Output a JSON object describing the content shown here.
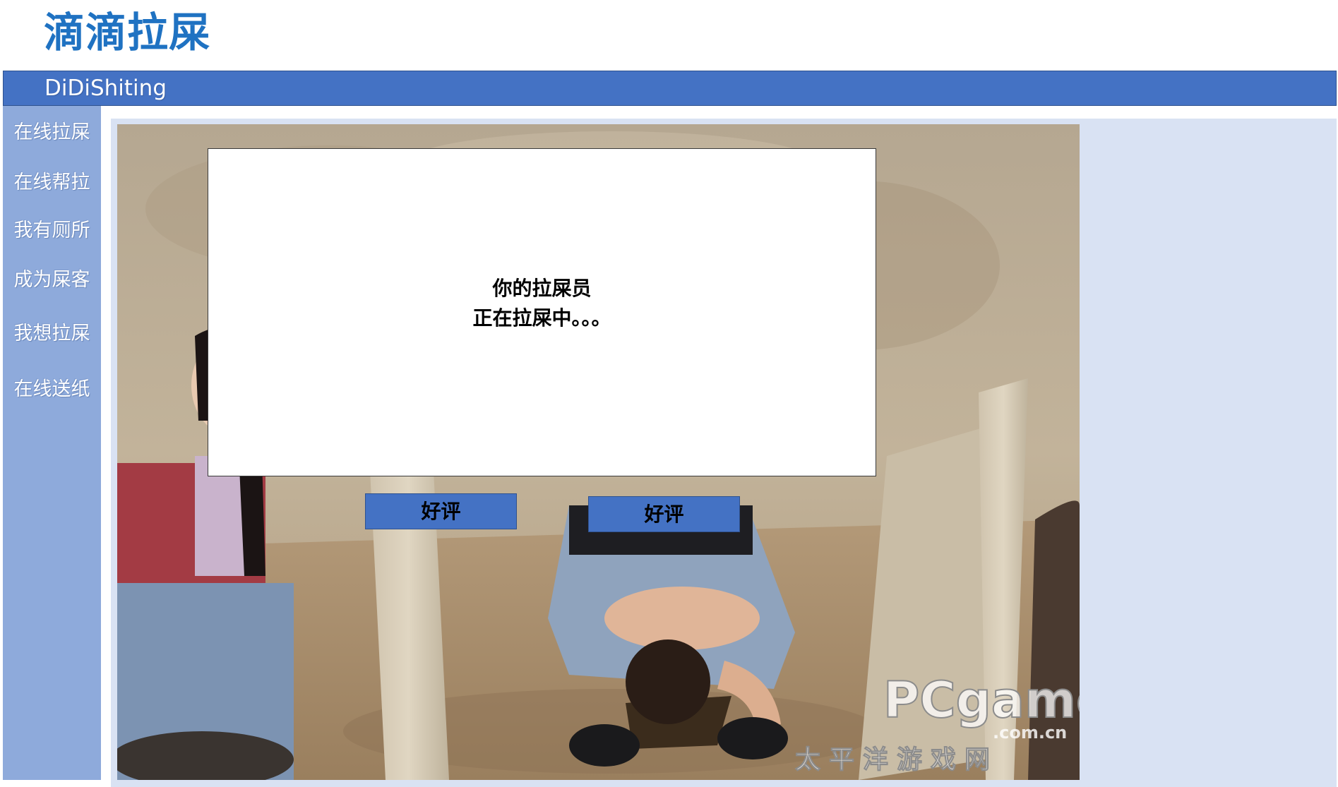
{
  "app": {
    "logo_text": "滴滴拉屎",
    "banner_text": "DiDiShiting"
  },
  "sidebar": {
    "items": [
      {
        "label": "在线拉屎"
      },
      {
        "label": "在线帮拉"
      },
      {
        "label": "我有厕所"
      },
      {
        "label": "成为屎客"
      },
      {
        "label": "我想拉屎"
      },
      {
        "label": "在线送纸"
      }
    ]
  },
  "photo": {
    "watermark_brand": "PCgames",
    "watermark_domain": ".com.cn",
    "watermark_cn": "太平洋游戏网"
  },
  "dialog": {
    "line1": "你的拉屎员",
    "line2": "正在拉屎中。。。"
  },
  "buttons": {
    "rate_left_label": "好评",
    "rate_right_label": "好评"
  },
  "colors": {
    "logo": "#1f72c2",
    "banner": "#4472c4",
    "sidebar": "#8eaadb",
    "content_bg": "#d9e2f3",
    "button": "#4472c4"
  }
}
